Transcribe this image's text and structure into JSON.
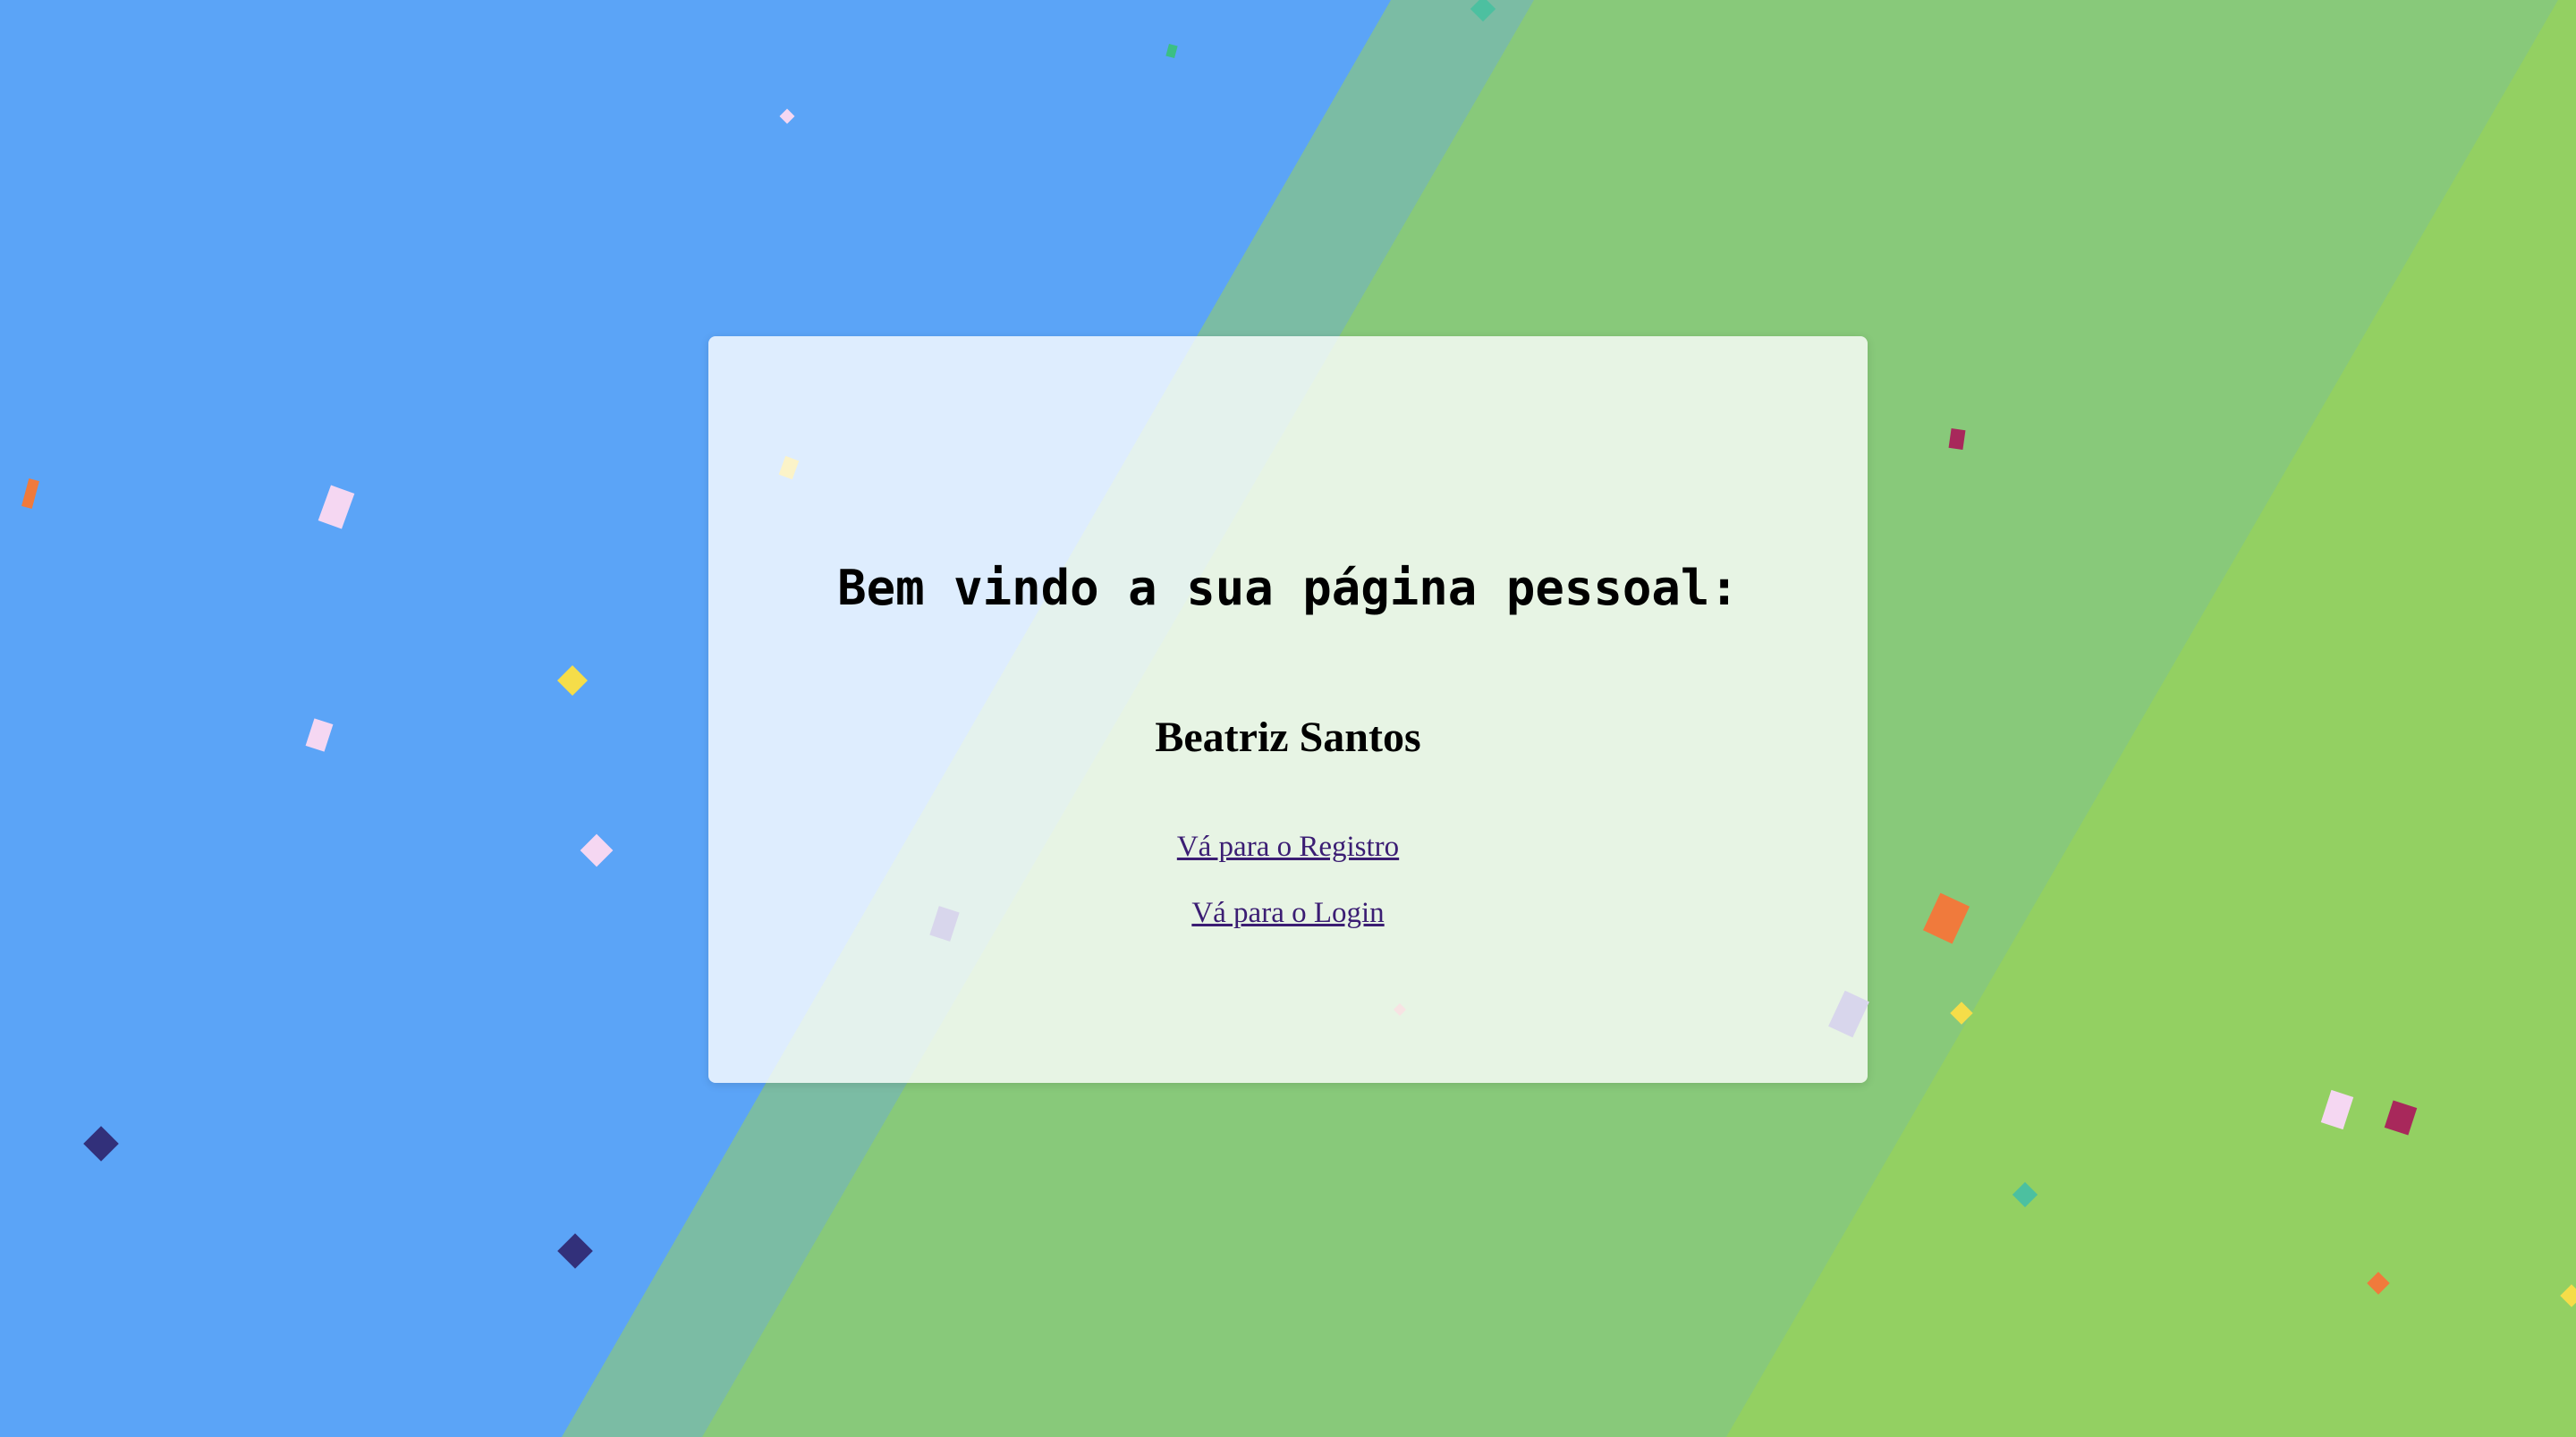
{
  "page": {
    "title": "Bem vindo a sua página pessoal:",
    "user_name": "Beatriz Santos"
  },
  "links": {
    "register_label": "Vá para o Registro",
    "login_label": "Vá para o Login"
  },
  "colors": {
    "background_blue": "#5ba4f7",
    "background_green": "#88c97a",
    "background_green_light": "#93d062",
    "band_teal": "#7bbca4",
    "link": "#3b1d73"
  },
  "icons": {
    "confetti": "confetti-piece"
  }
}
